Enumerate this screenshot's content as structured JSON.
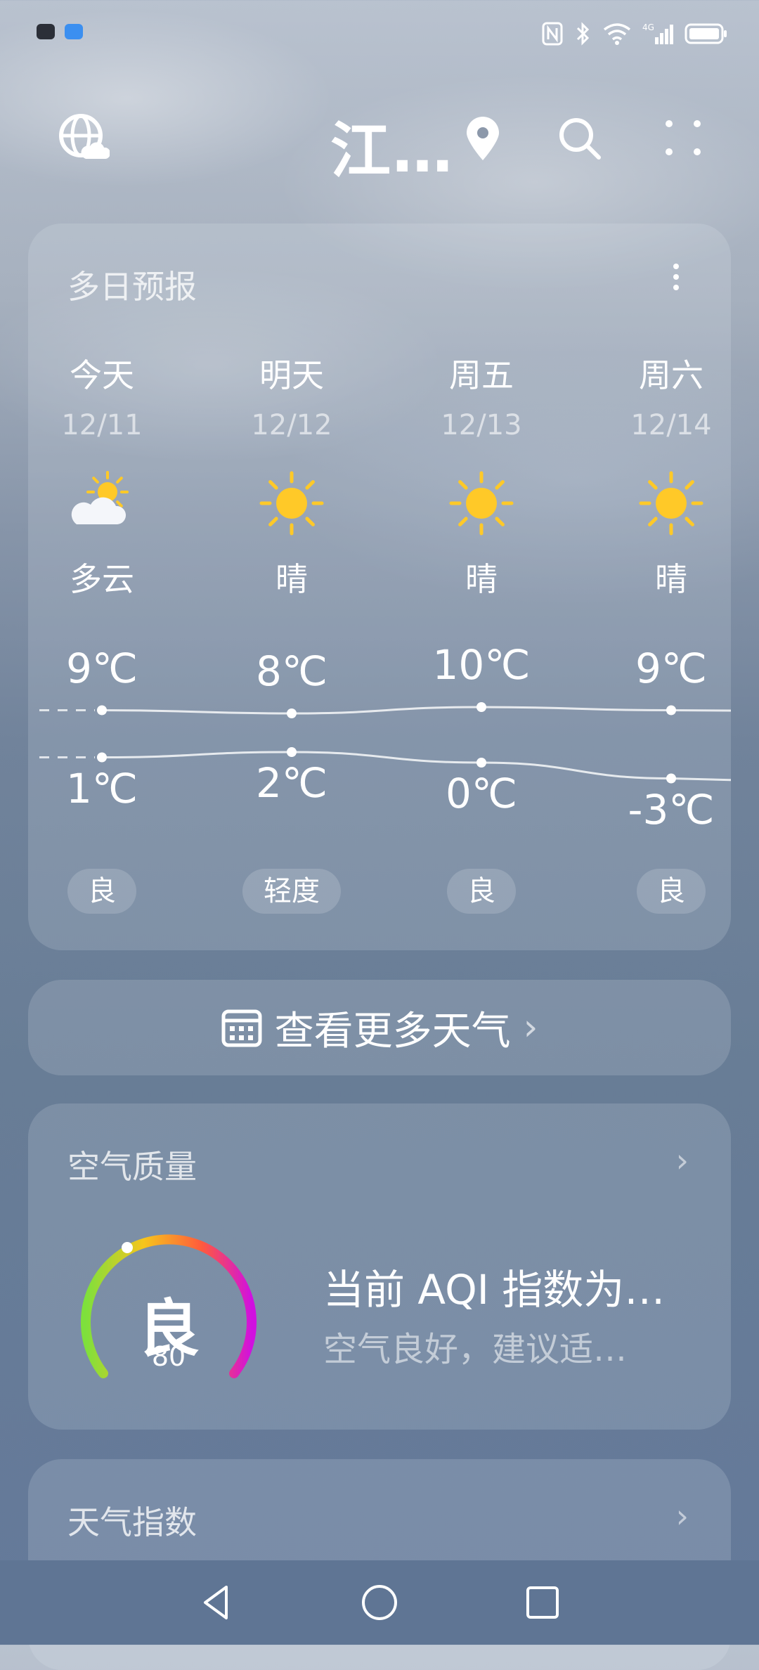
{
  "header": {
    "city": "江…"
  },
  "forecast": {
    "title": "多日预报",
    "days": [
      {
        "name": "今天",
        "date": "12/11",
        "icon": "partly-cloudy-icon",
        "condition": "多云",
        "high": "9℃",
        "low": "1℃",
        "aqi": "良",
        "high_val": 9,
        "low_val": 1
      },
      {
        "name": "明天",
        "date": "12/12",
        "icon": "sun-icon",
        "condition": "晴",
        "high": "8℃",
        "low": "2℃",
        "aqi": "轻度",
        "high_val": 8,
        "low_val": 2
      },
      {
        "name": "周五",
        "date": "12/13",
        "icon": "sun-icon",
        "condition": "晴",
        "high": "10℃",
        "low": "0℃",
        "aqi": "良",
        "high_val": 10,
        "low_val": 0
      },
      {
        "name": "周六",
        "date": "12/14",
        "icon": "sun-icon",
        "condition": "晴",
        "high": "9℃",
        "low": "-3℃",
        "aqi": "良",
        "high_val": 9,
        "low_val": -3
      }
    ]
  },
  "more_weather": {
    "label": "查看更多天气",
    "chevron": "›"
  },
  "air_quality": {
    "title": "空气质量",
    "chevron": "›",
    "level": "良",
    "value": "80",
    "headline": "当前 AQI 指数为…",
    "advice": "空气良好，建议适…"
  },
  "weather_index": {
    "title": "天气指数",
    "chevron": "›"
  },
  "colors": {
    "sun": "#ffc928",
    "gauge_start": "#7ee03c",
    "gauge_mid": "#f6c51c",
    "gauge_end": "#d010e0"
  }
}
